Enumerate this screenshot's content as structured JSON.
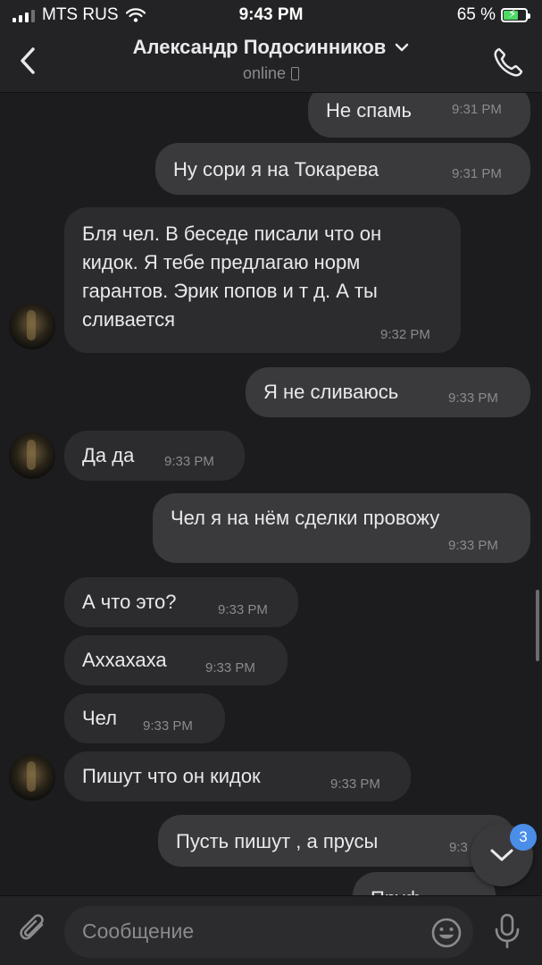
{
  "status_bar": {
    "carrier": "MTS RUS",
    "time": "9:43 PM",
    "battery_percent": "65 %",
    "battery_level": 0.65
  },
  "header": {
    "contact_name": "Александр Подосинников",
    "status": "online"
  },
  "messages": [
    {
      "direction": "out",
      "text": "Не спамь",
      "time": "9:31 PM"
    },
    {
      "direction": "out",
      "text": "Ну сори я на Токарева",
      "time": "9:31 PM"
    },
    {
      "direction": "in",
      "text": "Бля чел. В беседе писали что он кидок. Я тебе предлагаю норм гарантов. Эрик попов и т д. А ты сливается",
      "time": "9:32 PM"
    },
    {
      "direction": "out",
      "text": "Я не сливаюсь",
      "time": "9:33 PM"
    },
    {
      "direction": "in",
      "text": "Да да",
      "time": "9:33 PM"
    },
    {
      "direction": "out",
      "text": "Чел я на нём сделки провожу",
      "time": "9:33 PM"
    },
    {
      "direction": "in",
      "text": "А что это?",
      "time": "9:33 PM"
    },
    {
      "direction": "in",
      "text": "Аххахаха",
      "time": "9:33 PM"
    },
    {
      "direction": "in",
      "text": "Чел",
      "time": "9:33 PM"
    },
    {
      "direction": "in",
      "text": "Пишут что он кидок",
      "time": "9:33 PM"
    },
    {
      "direction": "out",
      "text": "Пусть пишут , а прусы",
      "time": "9:3"
    },
    {
      "direction": "out",
      "text": "Пруф",
      "time": ""
    }
  ],
  "scroll_down": {
    "unread_count": "3"
  },
  "composer": {
    "placeholder": "Сообщение",
    "value": ""
  },
  "colors": {
    "background": "#1c1c1e",
    "bubble_in": "#2c2c2e",
    "bubble_out": "#3a3a3c",
    "badge": "#4a8ee8",
    "battery_fill": "#4cd964"
  }
}
